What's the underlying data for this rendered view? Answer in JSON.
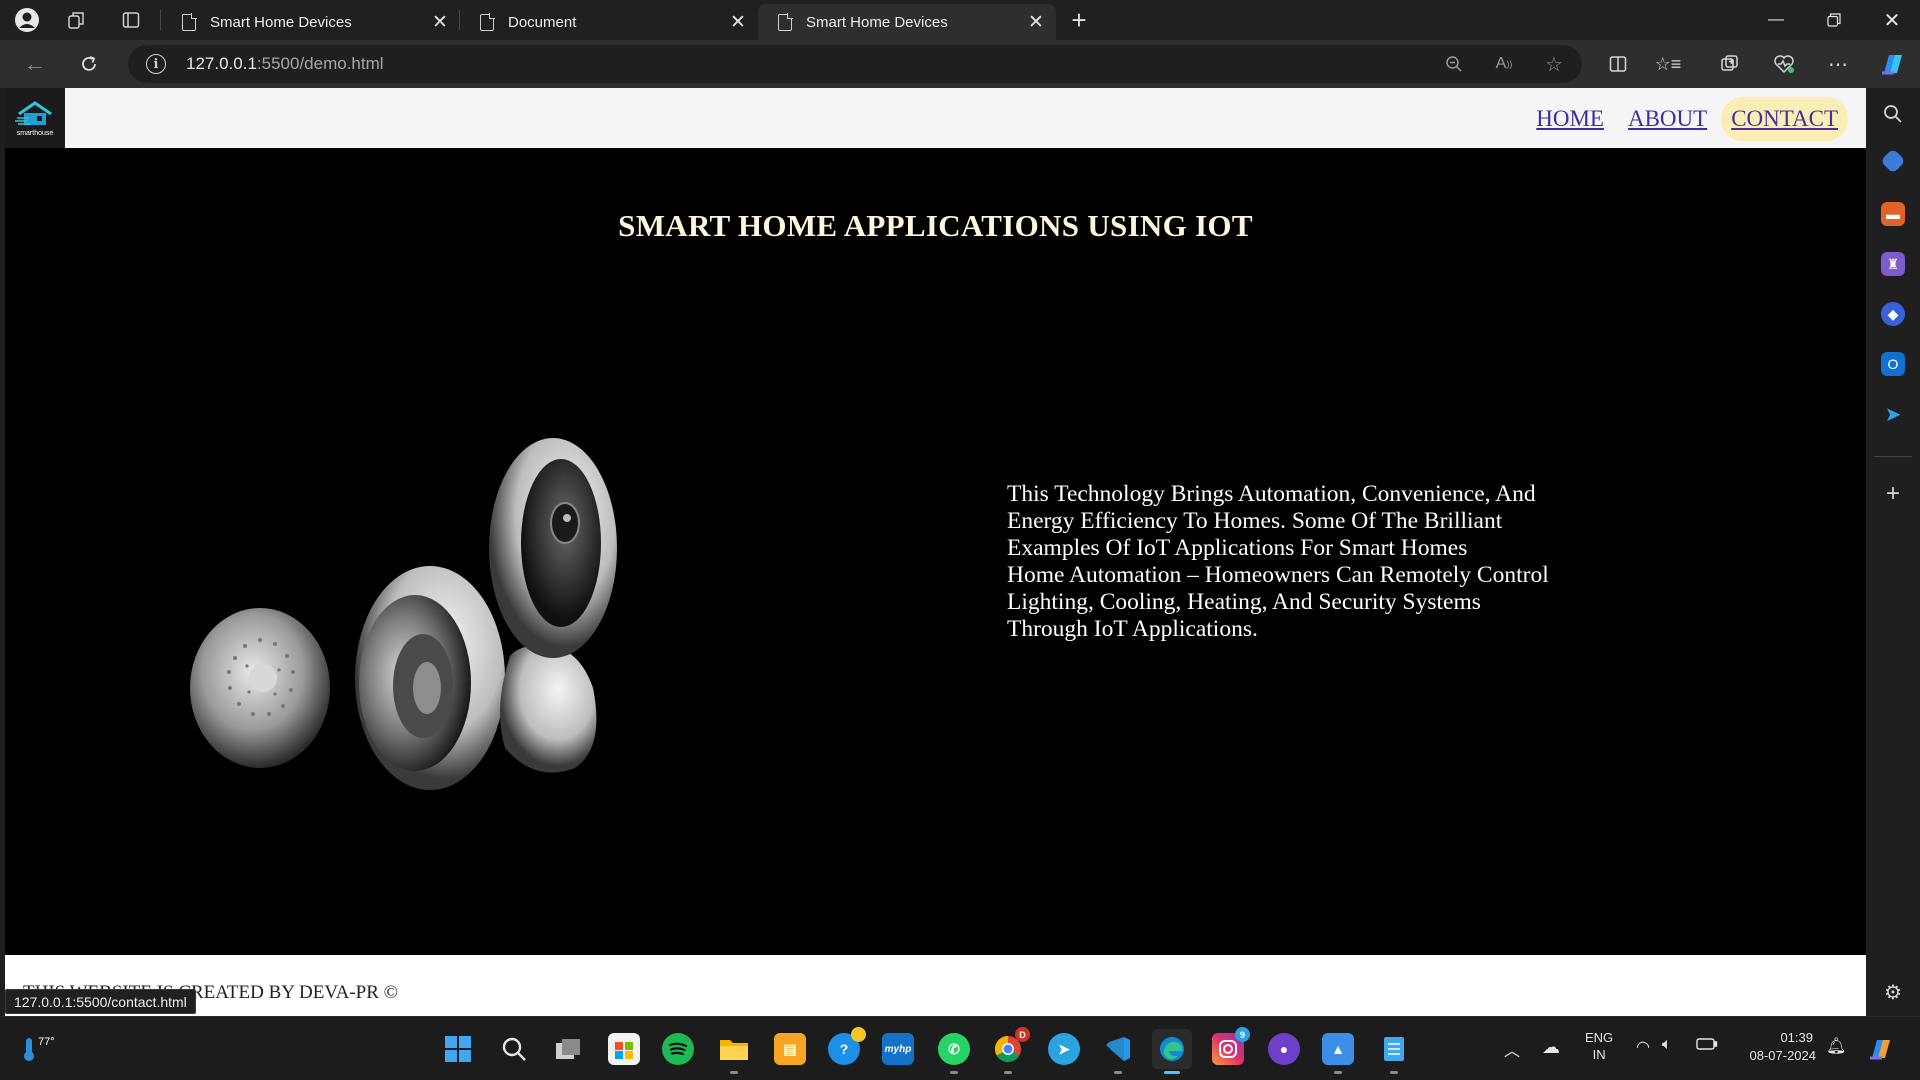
{
  "browser": {
    "tabs": [
      {
        "title": "Smart Home Devices",
        "active": false
      },
      {
        "title": "Document",
        "active": false
      },
      {
        "title": "Smart Home Devices",
        "active": true
      }
    ],
    "url_host": "127.0.0.1",
    "url_path": ":5500/demo.html",
    "status_url": "127.0.0.1:5500/contact.html"
  },
  "site": {
    "logo_text": "smarthouse",
    "nav": [
      {
        "label": "HOME",
        "active": false
      },
      {
        "label": "ABOUT",
        "active": false
      },
      {
        "label": "CONTACT",
        "active": true
      }
    ],
    "title": "SMART HOME APPLICATIONS USING IOT",
    "paragraph_lines": [
      "This Technology Brings Automation, Convenience, And",
      "Energy Efficiency To Homes. Some Of The Brilliant",
      "Examples Of IoT Applications For Smart Homes",
      "Home Automation – Homeowners Can Remotely Control",
      "Lighting, Cooling, Heating, And Security Systems",
      "Through IoT Applications."
    ],
    "footer": "THIS WEBSITE IS CREATED BY DEVA-PR ©"
  },
  "taskbar": {
    "weather_temp": "77°",
    "lang_line1": "ENG",
    "lang_line2": "IN",
    "time": "01:39",
    "date": "08-07-2024",
    "badges": {
      "chrome": "D",
      "instagram": "9"
    }
  },
  "colors": {
    "nav_link": "#3e2fa0",
    "nav_active_bg": "#fbeeb4",
    "title": "#fff5dc",
    "page_bg": "#000000"
  }
}
